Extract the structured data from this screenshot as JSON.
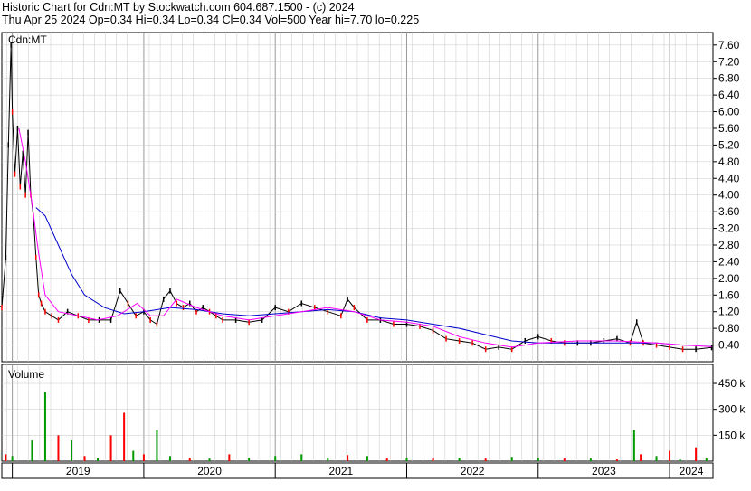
{
  "header": {
    "line1": "Historic Chart for Cdn:MT by Stockwatch.com 604.687.1500 - (c) 2024",
    "line2": "Thu Apr 25 2024  Op=0.34  Hi=0.34  Lo=0.34  Cl=0.34  Vol=500  Year hi=7.70  lo=0.225"
  },
  "chart_data": {
    "type": "line",
    "symbol_label": "Cdn:MT",
    "volume_label": "Volume",
    "x_labels": [
      "2019",
      "2020",
      "2021",
      "2022",
      "2023",
      "2024"
    ],
    "x_range": [
      "2018-11",
      "2024-04"
    ],
    "price_ticks": [
      "7.60",
      "7.20",
      "6.80",
      "6.40",
      "6.00",
      "5.60",
      "5.20",
      "4.80",
      "4.40",
      "4.00",
      "3.60",
      "3.20",
      "2.80",
      "2.40",
      "2.00",
      "1.60",
      "1.20",
      "0.80",
      "0.40"
    ],
    "ylim": [
      0,
      7.9
    ],
    "volume_ticks": [
      "450 k",
      "300 k",
      "150 k"
    ],
    "volume_ylim": [
      0,
      560000
    ],
    "grid": true,
    "colors": {
      "up": "#000000",
      "down": "#ff0000",
      "ma_short": "#ff00ff",
      "ma_long": "#0000cc",
      "vol_up": "#009900",
      "vol_down": "#ff0000",
      "grid": "#c8c8c8"
    },
    "price": {
      "x": [
        2018.88,
        2018.92,
        2018.95,
        2018.97,
        2018.99,
        2019.0,
        2019.02,
        2019.04,
        2019.06,
        2019.08,
        2019.1,
        2019.12,
        2019.14,
        2019.16,
        2019.18,
        2019.2,
        2019.22,
        2019.25,
        2019.3,
        2019.35,
        2019.42,
        2019.5,
        2019.58,
        2019.66,
        2019.75,
        2019.82,
        2019.88,
        2019.94,
        2020.0,
        2020.05,
        2020.1,
        2020.15,
        2020.2,
        2020.25,
        2020.3,
        2020.35,
        2020.4,
        2020.45,
        2020.5,
        2020.55,
        2020.6,
        2020.7,
        2020.8,
        2020.9,
        2021.0,
        2021.1,
        2021.2,
        2021.3,
        2021.4,
        2021.5,
        2021.55,
        2021.6,
        2021.7,
        2021.8,
        2021.9,
        2022.0,
        2022.1,
        2022.2,
        2022.3,
        2022.4,
        2022.5,
        2022.6,
        2022.7,
        2022.8,
        2022.9,
        2023.0,
        2023.1,
        2023.2,
        2023.3,
        2023.4,
        2023.5,
        2023.6,
        2023.7,
        2023.75,
        2023.8,
        2023.9,
        2024.0,
        2024.1,
        2024.2,
        2024.32
      ],
      "y": [
        1.4,
        1.3,
        2.5,
        5.2,
        7.6,
        6.0,
        4.5,
        5.6,
        4.2,
        5.0,
        4.0,
        5.5,
        4.0,
        3.5,
        2.5,
        1.6,
        1.4,
        1.2,
        1.1,
        1.0,
        1.2,
        1.1,
        1.0,
        1.0,
        1.0,
        1.7,
        1.4,
        1.1,
        1.2,
        1.0,
        0.9,
        1.5,
        1.7,
        1.4,
        1.3,
        1.4,
        1.2,
        1.3,
        1.2,
        1.1,
        1.0,
        1.0,
        0.95,
        1.0,
        1.3,
        1.2,
        1.4,
        1.3,
        1.2,
        1.1,
        1.5,
        1.3,
        1.0,
        1.0,
        0.9,
        0.9,
        0.85,
        0.75,
        0.55,
        0.5,
        0.45,
        0.3,
        0.35,
        0.3,
        0.5,
        0.6,
        0.5,
        0.45,
        0.45,
        0.45,
        0.5,
        0.55,
        0.45,
        0.95,
        0.45,
        0.4,
        0.35,
        0.3,
        0.3,
        0.34
      ]
    },
    "ma_short": {
      "x": [
        2019.05,
        2019.1,
        2019.15,
        2019.2,
        2019.25,
        2019.35,
        2019.5,
        2019.65,
        2019.8,
        2019.95,
        2020.05,
        2020.15,
        2020.25,
        2020.4,
        2020.6,
        2020.8,
        2021.0,
        2021.2,
        2021.4,
        2021.6,
        2021.8,
        2022.0,
        2022.2,
        2022.4,
        2022.6,
        2022.8,
        2023.0,
        2023.3,
        2023.6,
        2023.9,
        2024.1,
        2024.32
      ],
      "y": [
        5.6,
        4.8,
        3.8,
        2.6,
        1.6,
        1.2,
        1.1,
        1.0,
        1.1,
        1.4,
        1.1,
        1.1,
        1.5,
        1.3,
        1.1,
        1.0,
        1.1,
        1.2,
        1.3,
        1.2,
        1.0,
        0.95,
        0.85,
        0.6,
        0.45,
        0.35,
        0.45,
        0.5,
        0.5,
        0.45,
        0.4,
        0.36
      ]
    },
    "ma_long": {
      "x": [
        2019.18,
        2019.25,
        2019.35,
        2019.45,
        2019.55,
        2019.7,
        2019.85,
        2020.0,
        2020.2,
        2020.4,
        2020.6,
        2020.8,
        2021.0,
        2021.2,
        2021.4,
        2021.6,
        2021.8,
        2022.0,
        2022.2,
        2022.4,
        2022.6,
        2022.8,
        2023.0,
        2023.3,
        2023.6,
        2023.9,
        2024.1,
        2024.32
      ],
      "y": [
        3.7,
        3.5,
        2.8,
        2.1,
        1.6,
        1.3,
        1.15,
        1.2,
        1.3,
        1.25,
        1.15,
        1.1,
        1.15,
        1.2,
        1.25,
        1.2,
        1.05,
        1.0,
        0.9,
        0.8,
        0.65,
        0.5,
        0.45,
        0.45,
        0.45,
        0.45,
        0.4,
        0.4
      ]
    },
    "volume": {
      "x": [
        2018.9,
        2018.95,
        2019.0,
        2019.15,
        2019.25,
        2019.35,
        2019.45,
        2019.55,
        2019.65,
        2019.75,
        2019.85,
        2019.92,
        2020.0,
        2020.1,
        2020.2,
        2020.35,
        2020.5,
        2020.65,
        2020.8,
        2021.0,
        2021.2,
        2021.4,
        2021.55,
        2021.7,
        2021.85,
        2022.0,
        2022.2,
        2022.4,
        2022.6,
        2022.8,
        2023.0,
        2023.2,
        2023.4,
        2023.6,
        2023.73,
        2023.78,
        2023.9,
        2024.0,
        2024.08,
        2024.2,
        2024.28
      ],
      "y": [
        60000,
        40000,
        30000,
        120000,
        400000,
        150000,
        120000,
        30000,
        20000,
        150000,
        280000,
        60000,
        40000,
        180000,
        30000,
        20000,
        15000,
        40000,
        20000,
        30000,
        40000,
        20000,
        35000,
        30000,
        15000,
        20000,
        15000,
        20000,
        15000,
        25000,
        20000,
        15000,
        15000,
        10000,
        180000,
        40000,
        30000,
        60000,
        10000,
        80000,
        20000
      ],
      "up": [
        true,
        false,
        true,
        true,
        true,
        false,
        true,
        false,
        true,
        false,
        false,
        true,
        false,
        true,
        true,
        false,
        true,
        false,
        true,
        true,
        true,
        true,
        false,
        true,
        false,
        true,
        false,
        true,
        false,
        true,
        true,
        false,
        true,
        false,
        true,
        false,
        true,
        false,
        true,
        false,
        true
      ]
    }
  }
}
